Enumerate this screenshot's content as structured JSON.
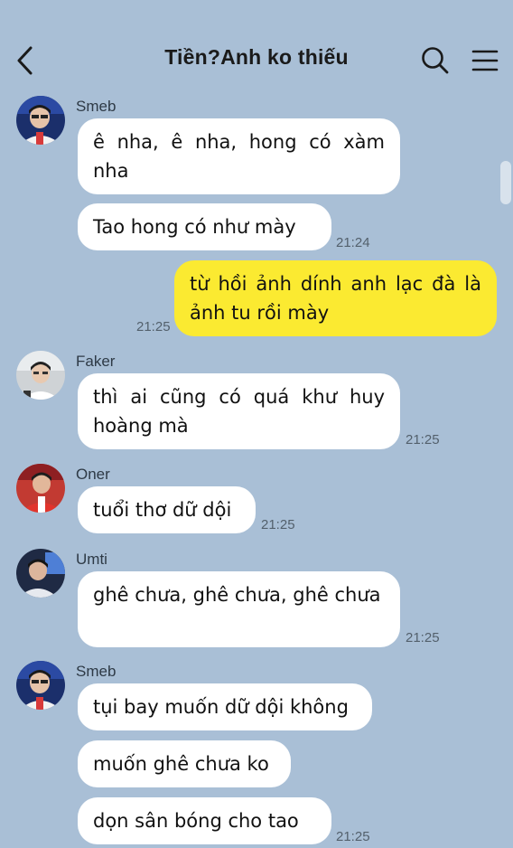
{
  "header": {
    "title": "Tiền?Anh ko thiếu",
    "back_icon": "back-chevron-icon",
    "search_icon": "search-icon",
    "menu_icon": "menu-icon"
  },
  "colors": {
    "background": "#a9bfd6",
    "incoming_bubble": "#ffffff",
    "outgoing_bubble": "#fbea31"
  },
  "messages": [
    {
      "sender": "Smeb",
      "text": "ê nha, ê nha, hong có xàm nha",
      "time": ""
    },
    {
      "sender": "Smeb",
      "text": "Tao hong có như mày",
      "time": "21:24"
    },
    {
      "sender": "me",
      "text": "từ hồi ảnh dính anh lạc đà là ảnh tu rồi mày",
      "time": "21:25"
    },
    {
      "sender": "Faker",
      "text": "thì ai cũng có quá khư huy hoàng mà",
      "time": "21:25"
    },
    {
      "sender": "Oner",
      "text": "tuổi thơ dữ dội",
      "time": "21:25"
    },
    {
      "sender": "Umti",
      "text": "ghê chưa, ghê chưa, ghê chưa",
      "time": "21:25"
    },
    {
      "sender": "Smeb",
      "text": "tụi bay muốn dữ dội không",
      "time": ""
    },
    {
      "sender": "Smeb",
      "text": "muốn ghê chưa ko",
      "time": ""
    },
    {
      "sender": "Smeb",
      "text": "dọn sân bóng cho tao",
      "time": "21:25"
    }
  ]
}
